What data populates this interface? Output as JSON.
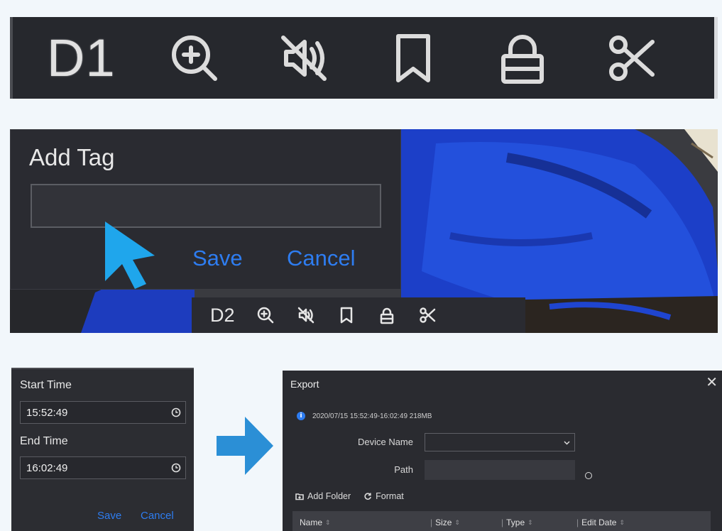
{
  "toolbar_large": {
    "channel": "D1",
    "icons": [
      "zoom-in-icon",
      "audio-off-icon",
      "tag-icon",
      "lock-icon",
      "clip-icon"
    ]
  },
  "add_tag": {
    "title": "Add Tag",
    "input_value": "",
    "save_label": "Save",
    "cancel_label": "Cancel",
    "mini_toolbar_channel": "D2",
    "accent": "#2e7df1",
    "cursor_color": "#1fa6ec"
  },
  "time_picker": {
    "start_label": "Start Time",
    "start_value": "15:52:49",
    "end_label": "End Time",
    "end_value": "16:02:49",
    "save_label": "Save",
    "cancel_label": "Cancel"
  },
  "export": {
    "title": "Export",
    "info": "2020/07/15 15:52:49-16:02:49   218MB",
    "device_name_label": "Device Name",
    "device_name_value": "",
    "path_label": "Path",
    "path_value": "",
    "add_folder_label": "Add Folder",
    "format_label": "Format",
    "columns": [
      "Name",
      "Size",
      "Type",
      "Edit Date"
    ]
  }
}
